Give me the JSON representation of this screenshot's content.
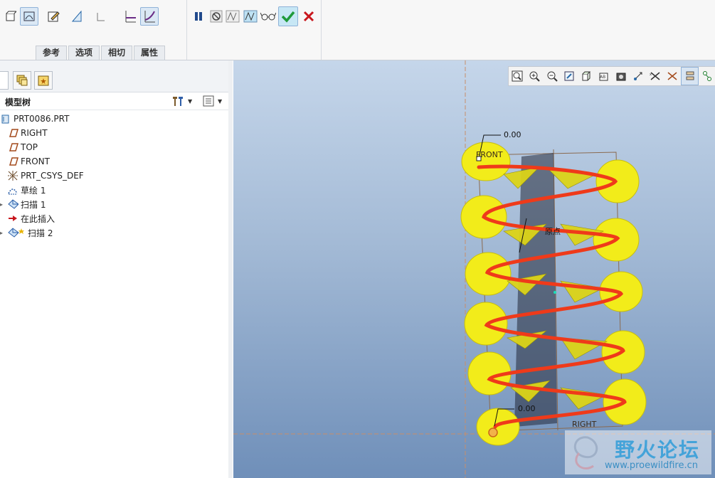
{
  "ribbon": {
    "tabs": [
      "参考",
      "选项",
      "相切",
      "属性"
    ],
    "tools_left": [
      "solid-icon",
      "surface-icon",
      "sketch-icon",
      "remove-material-icon",
      "thicken-icon",
      "constant-section-icon",
      "variable-section-icon"
    ],
    "tools_right": [
      "pause-icon",
      "no-preview-icon",
      "verify-preview-icon",
      "preview-icon",
      "glasses-icon",
      "confirm-icon",
      "cancel-icon"
    ]
  },
  "panel": {
    "title": "模型树",
    "tabs": [
      "layers-icon",
      "favorites-icon"
    ]
  },
  "tree": {
    "root": "PRT0086.PRT",
    "items": [
      {
        "label": "RIGHT",
        "icon": "datum-plane-icon"
      },
      {
        "label": "TOP",
        "icon": "datum-plane-icon"
      },
      {
        "label": "FRONT",
        "icon": "datum-plane-icon"
      },
      {
        "label": "PRT_CSYS_DEF",
        "icon": "csys-icon"
      },
      {
        "label": "草绘 1",
        "icon": "sketch-icon"
      },
      {
        "label": "扫描 1",
        "icon": "sweep-icon"
      },
      {
        "label": "在此插入",
        "icon": "insert-arrow-icon"
      },
      {
        "label": "扫描 2",
        "icon": "sweep-new-icon"
      }
    ]
  },
  "viewport": {
    "toolbar": [
      "refit-icon",
      "zoom-in-icon",
      "zoom-out-icon",
      "repaint-icon",
      "shading-icon",
      "saved-views-icon",
      "named-view-icon",
      "view-manager-icon",
      "spin-center-icon",
      "datum-display-icon",
      "planes-display-icon",
      "axes-display-icon"
    ],
    "labels": {
      "dim_top": "0.00",
      "dim_bottom": "0.00",
      "front": "FRONT",
      "right": "RIGHT",
      "origin": "原点"
    },
    "watermark": {
      "name": "野火论坛",
      "url": "www.proewildfire.cn"
    }
  }
}
